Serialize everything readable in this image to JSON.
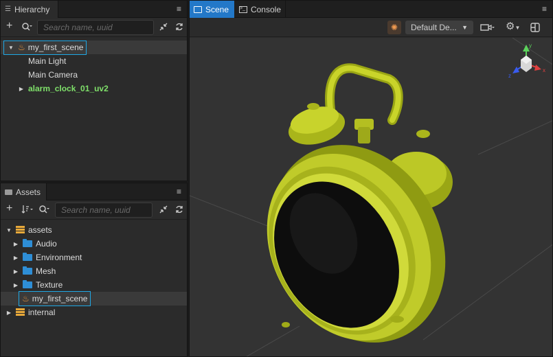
{
  "hierarchy": {
    "tab_label": "Hierarchy",
    "menu_glyph": "≡",
    "search_placeholder": "Search name, uuid",
    "nodes": [
      {
        "label": "my_first_scene",
        "icon": "scene-flame-icon"
      },
      {
        "label": "Main Light"
      },
      {
        "label": "Main Camera"
      },
      {
        "label": "alarm_clock_01_uv2",
        "color": "#7fe06a"
      }
    ]
  },
  "assets": {
    "tab_label": "Assets",
    "menu_glyph": "≡",
    "search_placeholder": "Search name, uuid",
    "items": [
      {
        "label": "assets",
        "icon": "database-icon"
      },
      {
        "label": "Audio",
        "icon": "folder-icon"
      },
      {
        "label": "Environment",
        "icon": "folder-icon"
      },
      {
        "label": "Mesh",
        "icon": "folder-icon"
      },
      {
        "label": "Texture",
        "icon": "folder-icon"
      },
      {
        "label": "my_first_scene",
        "icon": "scene-flame-icon"
      },
      {
        "label": "internal",
        "icon": "database-icon"
      }
    ]
  },
  "scene": {
    "tabs": [
      {
        "label": "Scene"
      },
      {
        "label": "Console"
      }
    ],
    "menu_glyph": "≡",
    "layer_dropdown": "Default De...",
    "gizmo_axes": {
      "x": "x",
      "y": "y",
      "z": "z"
    },
    "colors": {
      "clock_body": "#b6c21a",
      "clock_face": "#0d0d0d",
      "accent": "#2378c8",
      "selection": "#1fa8e6"
    }
  }
}
